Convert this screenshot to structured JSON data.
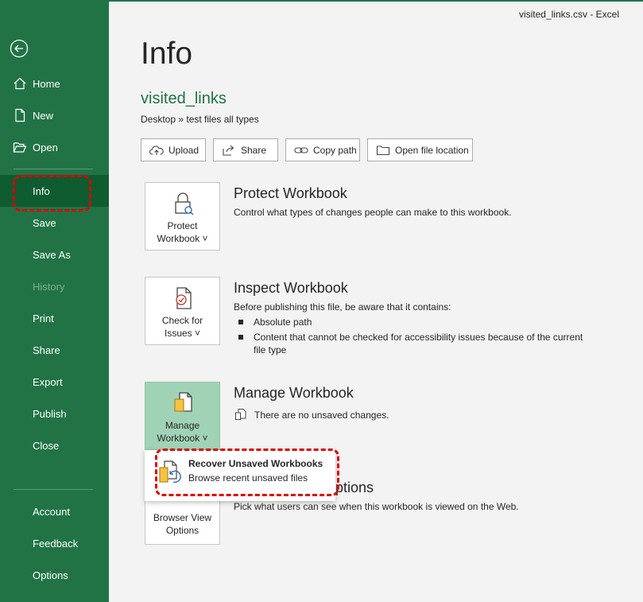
{
  "window": {
    "title": "visited_links.csv  -  Excel"
  },
  "sidebar": {
    "home": "Home",
    "new": "New",
    "open": "Open",
    "items": [
      "Info",
      "Save",
      "Save As",
      "History",
      "Print",
      "Share",
      "Export",
      "Publish",
      "Close"
    ],
    "footer": [
      "Account",
      "Feedback",
      "Options"
    ]
  },
  "main": {
    "title": "Info",
    "file_name": "visited_links",
    "file_path": "Desktop » test files all types",
    "actions": {
      "upload": "Upload",
      "share": "Share",
      "copy_path": "Copy path",
      "open_location": "Open file location"
    }
  },
  "protect": {
    "button_line1": "Protect",
    "button_line2": "Workbook ˅",
    "title": "Protect Workbook",
    "desc": "Control what types of changes people can make to this workbook."
  },
  "inspect": {
    "button_line1": "Check for",
    "button_line2": "Issues ˅",
    "title": "Inspect Workbook",
    "desc": "Before publishing this file, be aware that it contains:",
    "bullets": [
      "Absolute path",
      "Content that cannot be checked for accessibility issues because of the current file type"
    ]
  },
  "manage": {
    "button_line1": "Manage",
    "button_line2": "Workbook ˅",
    "title": "Manage Workbook",
    "desc": "There are no unsaved changes."
  },
  "browser": {
    "button_line1": "Browser View",
    "button_line2": "Options",
    "title": "ptions",
    "desc": "Pick what users can see when this workbook is viewed on the Web."
  },
  "dropdown": {
    "title": "Recover Unsaved Workbooks",
    "subtitle": "Browse recent unsaved files"
  }
}
